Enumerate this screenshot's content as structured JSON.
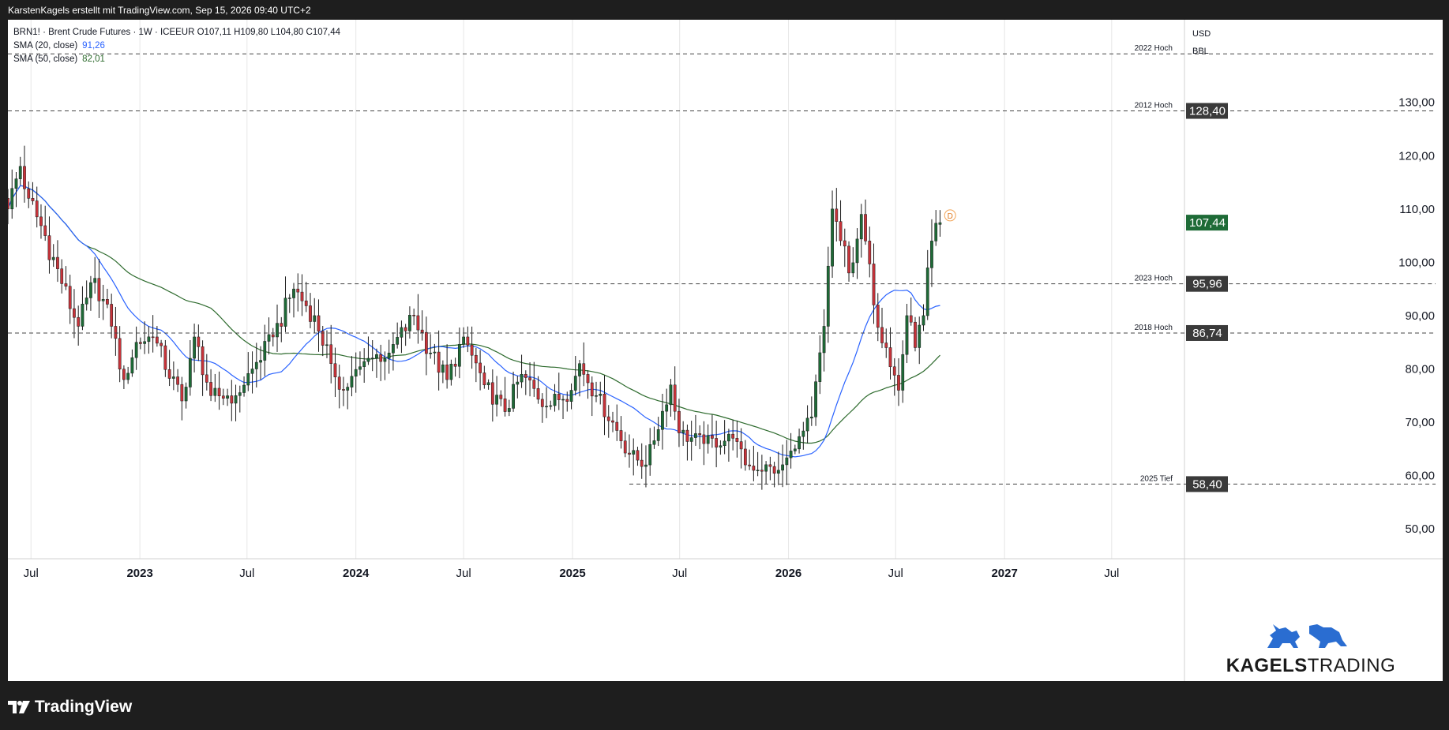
{
  "header": {
    "credit": "KarstenKagels erstellt mit TradingView.com, Sep 15, 2026 09:40 UTC+2"
  },
  "legend": {
    "line1": "BRN1! · Brent Crude Futures · 1W · ICEEUR  O107,11  H109,80  L104,80  C107,44",
    "sma20_label": "SMA (20, close)",
    "sma20_value": "91,26",
    "sma50_label": "SMA (50, close)",
    "sma50_value": "82,01"
  },
  "footer": {
    "brand": "TradingView"
  },
  "logo": {
    "text_bold": "KAGELS",
    "text_light": "TRADING"
  },
  "colors": {
    "up": "#1e6b37",
    "down": "#c8333a",
    "sma20": "#2962ff",
    "sma50": "#2e6b2e",
    "last": "#1e6b37",
    "level": "#444444"
  },
  "icons": [
    "tradingview-logo-icon",
    "bull-icon",
    "bear-icon",
    "dividend-marker-icon"
  ],
  "chart_data": {
    "type": "candlestick",
    "title": "BRN1! · Brent Crude Futures · 1W · ICEEUR",
    "currency": "USD",
    "unit": "BBL",
    "ylim": [
      44.4,
      145.5
    ],
    "x_range": [
      "2022-05-23",
      "2027-11-01"
    ],
    "y_ticks": [
      "50,00",
      "60,00",
      "70,00",
      "80,00",
      "90,00",
      "100,00",
      "110,00",
      "120,00",
      "130,00"
    ],
    "x_ticks": [
      {
        "label": "Jul",
        "date": "2022-07-01",
        "bold": false
      },
      {
        "label": "2023",
        "date": "2023-01-01",
        "bold": true
      },
      {
        "label": "Jul",
        "date": "2023-07-01",
        "bold": false
      },
      {
        "label": "2024",
        "date": "2024-01-01",
        "bold": true
      },
      {
        "label": "Jul",
        "date": "2024-07-01",
        "bold": false
      },
      {
        "label": "2025",
        "date": "2025-01-01",
        "bold": true
      },
      {
        "label": "Jul",
        "date": "2025-07-01",
        "bold": false
      },
      {
        "label": "2026",
        "date": "2026-01-01",
        "bold": true
      },
      {
        "label": "Jul",
        "date": "2026-07-01",
        "bold": false
      },
      {
        "label": "2027",
        "date": "2027-01-01",
        "bold": true
      },
      {
        "label": "Jul",
        "date": "2027-07-01",
        "bold": false
      }
    ],
    "levels": [
      {
        "name": "2022 Hoch",
        "value": 139.1,
        "from": "2022-05-23"
      },
      {
        "name": "2012 Hoch",
        "value": 128.4,
        "label": "128,40",
        "from": "2022-05-23"
      },
      {
        "name": "2023 Hoch",
        "value": 95.96,
        "label": "95,96",
        "from": "2023-09-25"
      },
      {
        "name": "2018 Hoch",
        "value": 86.74,
        "label": "86,74",
        "from": "2022-05-23"
      },
      {
        "name": "2025 Tief",
        "value": 58.4,
        "label": "58,40",
        "from": "2025-04-07"
      }
    ],
    "last_price": {
      "value": 107.44,
      "label": "107,44"
    },
    "dividend_marker": {
      "label": "D",
      "date": "2026-10-01",
      "value": 108.8
    },
    "anchors": [
      {
        "date": "2022-05-23",
        "close": 110
      },
      {
        "date": "2022-06-13",
        "close": 118
      },
      {
        "date": "2022-06-27",
        "close": 112
      },
      {
        "date": "2022-07-25",
        "close": 105
      },
      {
        "date": "2022-08-22",
        "close": 96
      },
      {
        "date": "2022-09-19",
        "close": 88
      },
      {
        "date": "2022-10-17",
        "close": 97
      },
      {
        "date": "2022-11-14",
        "close": 88
      },
      {
        "date": "2022-12-05",
        "close": 78
      },
      {
        "date": "2022-12-26",
        "close": 85
      },
      {
        "date": "2023-01-23",
        "close": 86
      },
      {
        "date": "2023-03-13",
        "close": 74
      },
      {
        "date": "2023-04-03",
        "close": 86
      },
      {
        "date": "2023-05-01",
        "close": 75
      },
      {
        "date": "2023-06-12",
        "close": 75
      },
      {
        "date": "2023-07-10",
        "close": 80
      },
      {
        "date": "2023-08-14",
        "close": 86
      },
      {
        "date": "2023-09-18",
        "close": 95
      },
      {
        "date": "2023-10-23",
        "close": 90
      },
      {
        "date": "2023-11-20",
        "close": 81
      },
      {
        "date": "2023-12-11",
        "close": 76
      },
      {
        "date": "2024-01-22",
        "close": 82
      },
      {
        "date": "2024-02-26",
        "close": 83
      },
      {
        "date": "2024-04-08",
        "close": 90
      },
      {
        "date": "2024-05-06",
        "close": 83
      },
      {
        "date": "2024-06-03",
        "close": 78
      },
      {
        "date": "2024-07-01",
        "close": 86
      },
      {
        "date": "2024-08-05",
        "close": 77
      },
      {
        "date": "2024-09-09",
        "close": 72
      },
      {
        "date": "2024-10-07",
        "close": 79
      },
      {
        "date": "2024-11-18",
        "close": 73
      },
      {
        "date": "2024-12-30",
        "close": 76
      },
      {
        "date": "2025-01-13",
        "close": 81
      },
      {
        "date": "2025-02-10",
        "close": 75
      },
      {
        "date": "2025-03-10",
        "close": 70
      },
      {
        "date": "2025-04-07",
        "close": 64
      },
      {
        "date": "2025-05-05",
        "close": 62
      },
      {
        "date": "2025-06-16",
        "close": 77
      },
      {
        "date": "2025-06-30",
        "close": 68
      },
      {
        "date": "2025-08-11",
        "close": 66
      },
      {
        "date": "2025-09-29",
        "close": 67
      },
      {
        "date": "2025-10-20",
        "close": 62
      },
      {
        "date": "2025-12-15",
        "close": 61
      },
      {
        "date": "2026-01-12",
        "close": 65
      },
      {
        "date": "2026-02-09",
        "close": 71
      },
      {
        "date": "2026-03-02",
        "close": 88
      },
      {
        "date": "2026-03-16",
        "close": 110
      },
      {
        "date": "2026-04-13",
        "close": 98
      },
      {
        "date": "2026-05-04",
        "close": 109
      },
      {
        "date": "2026-05-25",
        "close": 92
      },
      {
        "date": "2026-06-15",
        "close": 84
      },
      {
        "date": "2026-07-06",
        "close": 76
      },
      {
        "date": "2026-07-20",
        "close": 90
      },
      {
        "date": "2026-08-03",
        "close": 84
      },
      {
        "date": "2026-08-17",
        "close": 90
      },
      {
        "date": "2026-08-31",
        "close": 104
      },
      {
        "date": "2026-09-14",
        "close": 107.44
      }
    ],
    "last_bar": {
      "date": "2026-09-14",
      "open": 107.11,
      "high": 109.8,
      "low": 104.8,
      "close": 107.44
    },
    "sma20_last": 91.26,
    "sma50_last": 82.01
  }
}
